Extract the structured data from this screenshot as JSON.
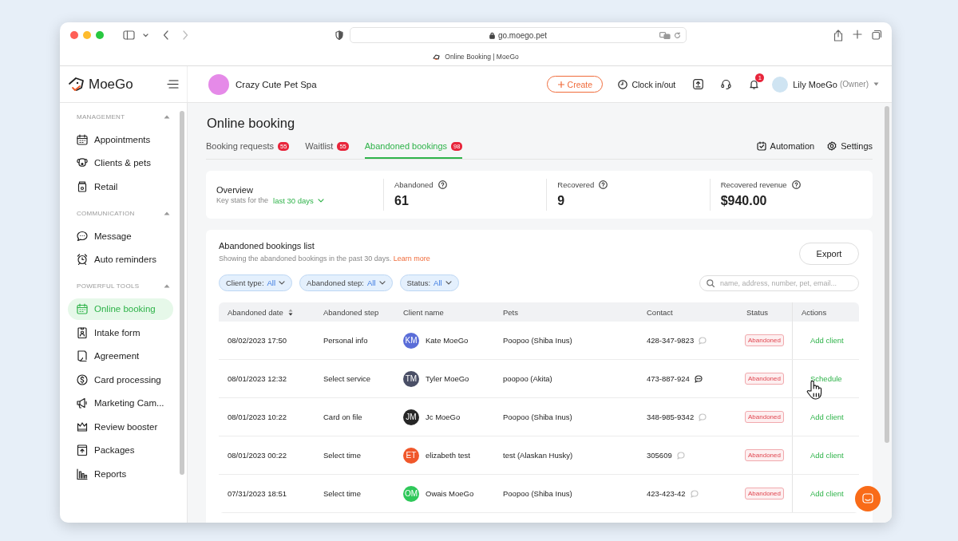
{
  "browser": {
    "url": "go.moego.pet",
    "tab_title": "Online Booking | MoeGo"
  },
  "header": {
    "brand": "MoeGo",
    "business": "Crazy Cute Pet Spa",
    "create": "Create",
    "clock": "Clock in/out",
    "notifications": "1",
    "user": "Lily MoeGo",
    "role": "(Owner)"
  },
  "sidebar": {
    "sections": [
      {
        "title": "MANAGEMENT",
        "expanded": true,
        "items": [
          {
            "label": "Appointments",
            "selected": false
          },
          {
            "label": "Clients & pets",
            "selected": false
          },
          {
            "label": "Retail",
            "selected": false
          }
        ]
      },
      {
        "title": "COMMUNICATION",
        "expanded": true,
        "items": [
          {
            "label": "Message",
            "selected": false
          },
          {
            "label": "Auto reminders",
            "selected": false
          }
        ]
      },
      {
        "title": "POWERFUL TOOLS",
        "expanded": true,
        "items": [
          {
            "label": "Online booking",
            "selected": true
          },
          {
            "label": "Intake form",
            "selected": false
          },
          {
            "label": "Agreement",
            "selected": false
          },
          {
            "label": "Card processing",
            "selected": false
          },
          {
            "label": "Marketing Cam...",
            "selected": false
          },
          {
            "label": "Review booster",
            "selected": false
          },
          {
            "label": "Packages",
            "selected": false
          },
          {
            "label": "Reports",
            "selected": false
          }
        ]
      }
    ]
  },
  "page": {
    "title": "Online booking",
    "tabs": [
      {
        "label": "Booking requests",
        "count": "55",
        "selected": false
      },
      {
        "label": "Waitlist",
        "count": "55",
        "selected": false
      },
      {
        "label": "Abandoned bookings",
        "count": "98",
        "selected": true
      }
    ],
    "tools": [
      "Automation",
      "Settings"
    ],
    "overview": {
      "title": "Overview",
      "subtitle": "Key stats for the",
      "range": "last 30 days",
      "stats": [
        {
          "label": "Abandoned",
          "value": "61"
        },
        {
          "label": "Recovered",
          "value": "9"
        },
        {
          "label": "Recovered revenue",
          "value": "$940.00"
        }
      ]
    },
    "list": {
      "title": "Abandoned bookings list",
      "description": "Showing the abandoned bookings in the past 30 days.",
      "link": "Learn more",
      "export": "Export",
      "filters": [
        {
          "label": "Client type:",
          "value": "All"
        },
        {
          "label": "Abandoned step:",
          "value": "All"
        },
        {
          "label": "Status:",
          "value": "All"
        }
      ],
      "search": {
        "placeholder": "name, address, number, pet, email..."
      },
      "columns": [
        {
          "label": "Abandoned date",
          "sortable": true
        },
        {
          "label": "Abandoned step",
          "sortable": false
        },
        {
          "label": "Client name",
          "sortable": false
        },
        {
          "label": "Pets",
          "sortable": false
        },
        {
          "label": "Contact",
          "sortable": false
        },
        {
          "label": "Status",
          "sortable": false
        },
        {
          "label": "Actions",
          "sortable": false
        }
      ],
      "rows": [
        {
          "date": "08/02/2023 17:50",
          "step": "Personal info",
          "initials": "KM",
          "color": "#5a6dd8",
          "client": "Kate MoeGo",
          "pets": "Poopoo (Shiba Inus)",
          "contact": "428-347-9823",
          "chat_active": false,
          "status": "Abandoned",
          "action": "Add client"
        },
        {
          "date": "08/01/2023 12:32",
          "step": "Select service",
          "initials": "TM",
          "color": "#4a4f66",
          "client": "Tyler MoeGo",
          "pets": "poopoo (Akita)",
          "contact": "473-887-924",
          "chat_active": true,
          "status": "Abandoned",
          "action": "Schedule"
        },
        {
          "date": "08/01/2023 10:22",
          "step": "Card on file",
          "initials": "JM",
          "color": "#262626",
          "client": "Jc MoeGo",
          "pets": "Poopoo (Shiba Inus)",
          "contact": "348-985-9342",
          "chat_active": false,
          "status": "Abandoned",
          "action": "Add client"
        },
        {
          "date": "08/01/2023 00:22",
          "step": "Select time",
          "initials": "ET",
          "color": "#f0572a",
          "client": "elizabeth test",
          "pets": "test (Alaskan Husky)",
          "contact": "305609",
          "chat_active": false,
          "status": "Abandoned",
          "action": "Add client"
        },
        {
          "date": "07/31/2023 18:51",
          "step": "Select time",
          "initials": "OM",
          "color": "#2fc85a",
          "client": "Owais MoeGo",
          "pets": "Poopoo (Shiba Inus)",
          "contact": "423-423-42",
          "chat_active": false,
          "status": "Abandoned",
          "action": "Add client"
        }
      ]
    }
  }
}
